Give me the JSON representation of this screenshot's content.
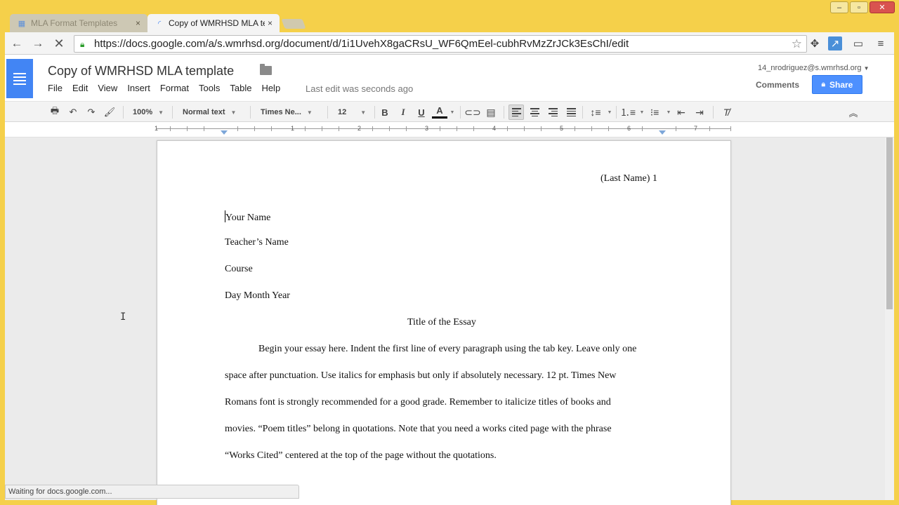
{
  "browser": {
    "tabs": [
      {
        "label": "MLA Format Templates",
        "active": false
      },
      {
        "label": "Copy of WMRHSD MLA te",
        "active": true
      }
    ],
    "url": "https://docs.google.com/a/s.wmrhsd.org/document/d/1i1UvehX8gaCRsU_WF6QmEel-cubhRvMzZrJCk3EsChI/edit",
    "status_text": "Waiting for docs.google.com..."
  },
  "docs": {
    "title": "Copy of WMRHSD MLA template",
    "menu": [
      "File",
      "Edit",
      "View",
      "Insert",
      "Format",
      "Tools",
      "Table",
      "Help"
    ],
    "last_edit": "Last edit was seconds ago",
    "user_email": "14_nrodriguez@s.wmrhsd.org",
    "comments_label": "Comments",
    "share_label": "Share"
  },
  "toolbar": {
    "zoom": "100%",
    "style": "Normal text",
    "font": "Times Ne...",
    "size": "12"
  },
  "ruler": {
    "numbers": [
      "1",
      "1",
      "2",
      "3",
      "4",
      "5",
      "6",
      "7"
    ]
  },
  "document": {
    "header": "(Last Name) 1",
    "lines": [
      "Your Name",
      "Teacher’s Name",
      "Course",
      "Day Month Year"
    ],
    "essay_title": "Title of the Essay",
    "body_lines": [
      "Begin your essay here. Indent the first line of every paragraph using the tab key. Leave only one",
      "space after punctuation. Use italics for emphasis but only if absolutely necessary. 12 pt. Times New",
      "Romans font is strongly recommended for a good grade. Remember to italicize titles of books and",
      "movies. “Poem titles” belong in quotations. Note that you need a works cited page with the phrase",
      "“Works Cited” centered at the top of the page without the quotations."
    ]
  },
  "colors": {
    "window_frame": "#f5d04a",
    "docs_blue": "#4285f4",
    "share_blue": "#4d90fe"
  }
}
